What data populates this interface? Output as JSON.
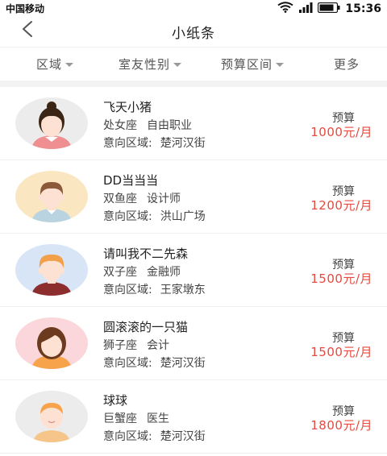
{
  "status_bar": {
    "carrier": "中国移动",
    "time": "15:36",
    "icons": [
      "wifi-icon",
      "signal-icon",
      "battery-icon"
    ]
  },
  "nav": {
    "title": "小纸条",
    "back_icon": "chevron-left-icon"
  },
  "filters": [
    {
      "label": "区域",
      "has_caret": true
    },
    {
      "label": "室友性别",
      "has_caret": true
    },
    {
      "label": "预算区间",
      "has_caret": true
    },
    {
      "label": "更多",
      "has_caret": false
    }
  ],
  "list": [
    {
      "name": "飞天小猪",
      "zodiac": "处女座",
      "job": "自由职业",
      "area_label": "意向区域:",
      "area": "楚河汉街",
      "budget_label": "预算",
      "budget": "1000元/月",
      "avatar": "girl-bun-avatar",
      "avatar_bg": "#ececec"
    },
    {
      "name": "DD当当当",
      "zodiac": "双鱼座",
      "job": "设计师",
      "area_label": "意向区域:",
      "area": "洪山广场",
      "budget_label": "预算",
      "budget": "1200元/月",
      "avatar": "boy-brown-hair-avatar",
      "avatar_bg": "#fbe6c2"
    },
    {
      "name": "请叫我不二先森",
      "zodiac": "双子座",
      "job": "金融师",
      "area_label": "意向区域:",
      "area": "王家墩东",
      "budget_label": "预算",
      "budget": "1500元/月",
      "avatar": "boy-orange-hair-avatar",
      "avatar_bg": "#d8e5f7"
    },
    {
      "name": "圆滚滚的一只猫",
      "zodiac": "狮子座",
      "job": "会计",
      "area_label": "意向区域:",
      "area": "楚河汉街",
      "budget_label": "预算",
      "budget": "1500元/月",
      "avatar": "girl-bob-avatar",
      "avatar_bg": "#fbd6da"
    },
    {
      "name": "球球",
      "zodiac": "巨蟹座",
      "job": "医生",
      "area_label": "意向区域:",
      "area": "楚河汉街",
      "budget_label": "预算",
      "budget": "1800元/月",
      "avatar": "kid-avatar",
      "avatar_bg": "#ececec"
    }
  ],
  "colors": {
    "price": "#e8493e",
    "divider": "#f3f3f3"
  }
}
